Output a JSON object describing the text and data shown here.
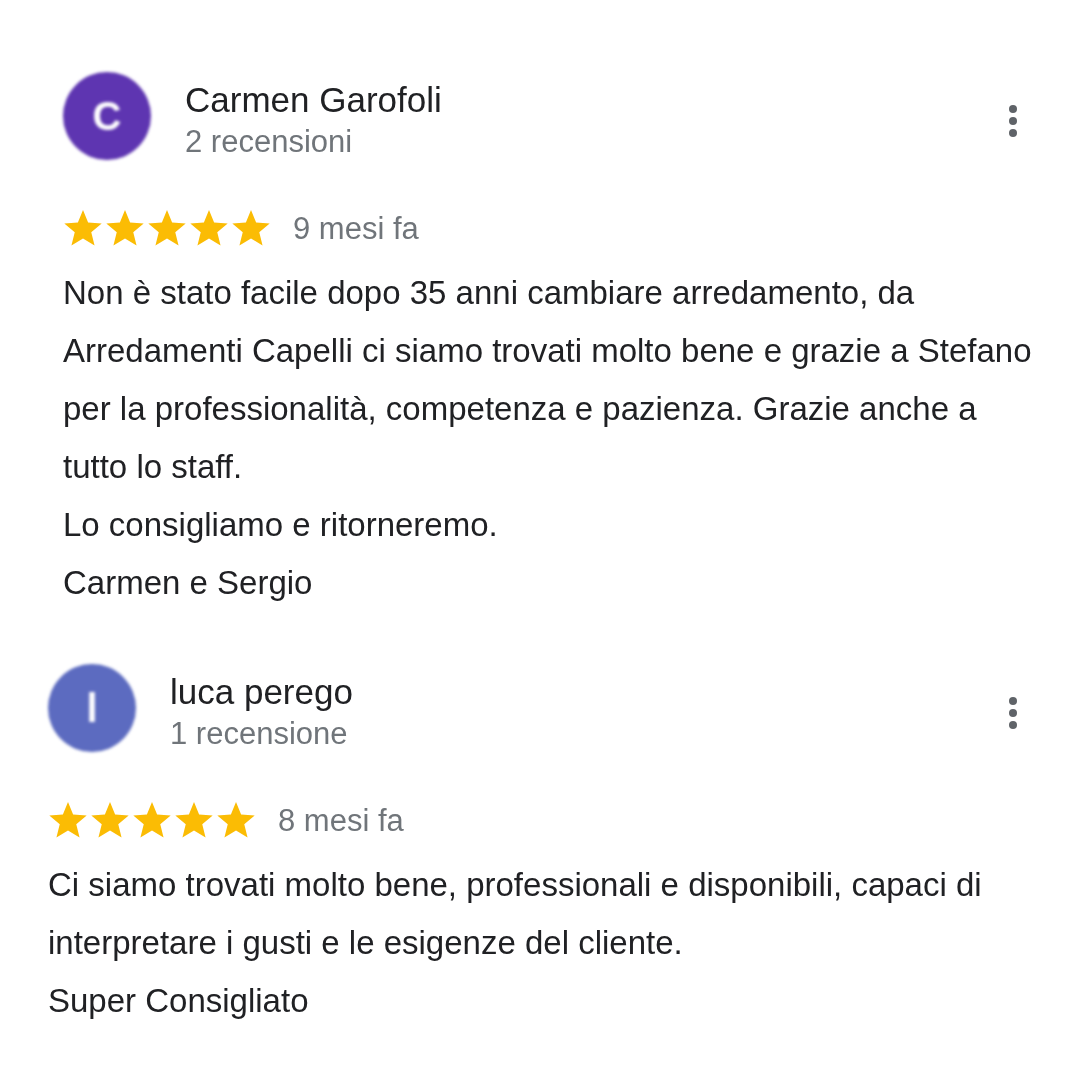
{
  "reviews": [
    {
      "initial": "C",
      "color": "#5e35b1",
      "name": "Carmen Garofoli",
      "count": "2 recensioni",
      "stars": 5,
      "time": "9 mesi fa",
      "text": "Non è stato facile dopo 35 anni cambiare arredamento, da Arredamenti Capelli ci siamo trovati molto bene e grazie a Stefano per la professionalità, competenza e pazienza. Grazie anche a tutto lo staff.\nLo consigliamo e ritorneremo.\nCarmen e Sergio"
    },
    {
      "initial": "l",
      "color": "#5c6bc0",
      "name": "luca perego",
      "count": "1 recensione",
      "stars": 5,
      "time": "8 mesi fa",
      "text": "Ci siamo trovati molto bene, professionali e disponibili, capaci di interpretare i gusti e le esigenze del cliente.\nSuper Consigliato"
    }
  ]
}
